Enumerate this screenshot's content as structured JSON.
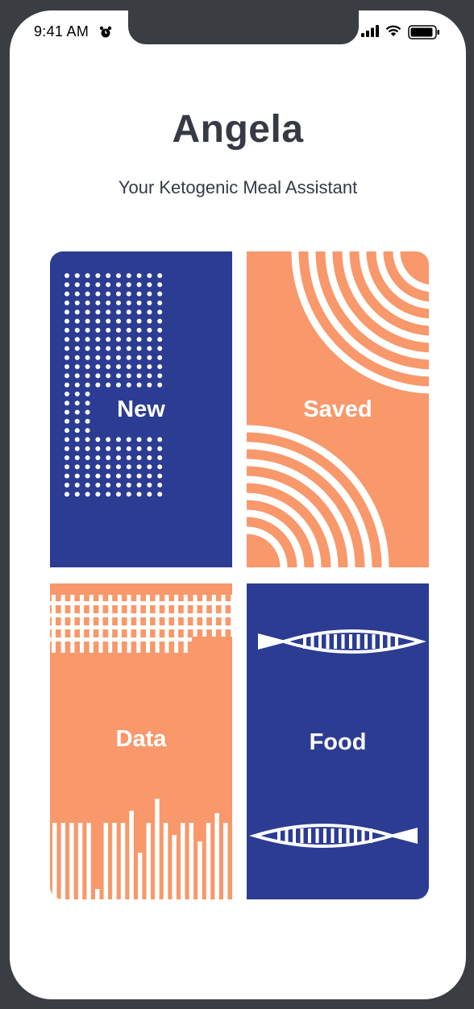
{
  "status_bar": {
    "time": "9:41 AM",
    "icons": [
      "alarm-icon",
      "signal-icon",
      "wifi-icon",
      "battery-icon"
    ]
  },
  "header": {
    "title": "Angela",
    "subtitle": "Your Ketogenic Meal Assistant"
  },
  "cards": {
    "new": {
      "label": "New"
    },
    "saved": {
      "label": "Saved"
    },
    "data": {
      "label": "Data"
    },
    "food": {
      "label": "Food"
    }
  },
  "colors": {
    "navy": "#2c3c93",
    "orange": "#f8986b",
    "text": "#363a44"
  }
}
